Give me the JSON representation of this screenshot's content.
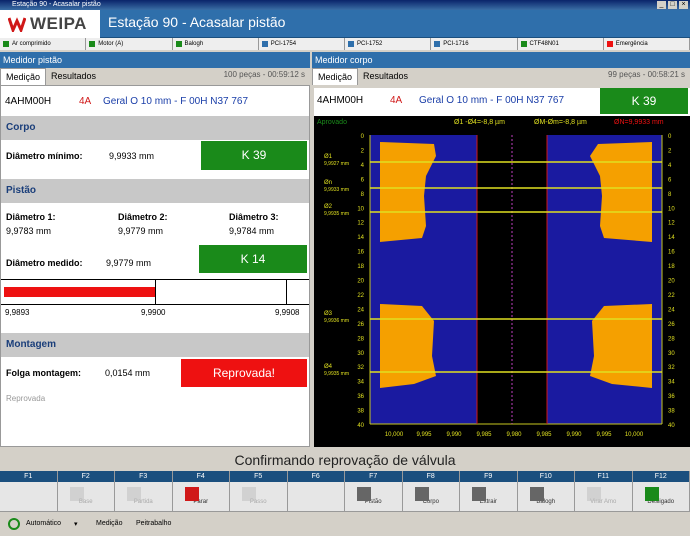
{
  "window": {
    "title": "Estação 90 - Acasalar pistão"
  },
  "header": {
    "logo": "WEIPA",
    "title": "Estação 90 - Acasalar pistão"
  },
  "status": [
    {
      "label": "Ar comprimido",
      "color": "#1a8a1a"
    },
    {
      "label": "Motor (A)",
      "color": "#1a8a1a"
    },
    {
      "label": "Balogh",
      "color": "#1a8a1a"
    },
    {
      "label": "PCI-1754",
      "color": "#2f6fab"
    },
    {
      "label": "PCI-1752",
      "color": "#2f6fab"
    },
    {
      "label": "PCI-1716",
      "color": "#2f6fab"
    },
    {
      "label": "CTF48N01",
      "color": "#1a8a1a"
    },
    {
      "label": "Emergência",
      "color": "#ee1111"
    }
  ],
  "left": {
    "head": "Medidor pistão",
    "tabs": [
      "Medição",
      "Resultados"
    ],
    "count": "100 peças - 00:59:12 s",
    "code": "4AHM00H",
    "cls": "4A",
    "desc": "Geral O 10 mm - F 00H N37 767",
    "corpo": {
      "title": "Corpo",
      "label": "Diâmetro mínimo:",
      "value": "9,9933 mm",
      "k": "K 39"
    },
    "pistao": {
      "title": "Pistão",
      "d1l": "Diâmetro 1:",
      "d1": "9,9783 mm",
      "d2l": "Diâmetro 2:",
      "d2": "9,9779 mm",
      "d3l": "Diâmetro 3:",
      "d3": "9,9784 mm",
      "medl": "Diâmetro medido:",
      "med": "9,9779 mm",
      "k": "K 14"
    },
    "scale": {
      "a": "9,9893",
      "b": "9,9900",
      "c": "9,9908",
      "level": 0.5
    },
    "montagem": {
      "title": "Montagem",
      "label": "Folga montagem:",
      "value": "0,0154 mm",
      "status": "Reprovada!",
      "note": "Reprovada"
    }
  },
  "right": {
    "head": "Medidor corpo",
    "tabs": [
      "Medição",
      "Resultados"
    ],
    "count": "99 peças - 00:58:21 s",
    "code": "4AHM00H",
    "cls": "4A",
    "desc": "Geral O 10 mm - F 00H N37 767",
    "k": "K 39",
    "chart": {
      "status": "Aprovado",
      "leg1": "Ø1 -Ø4=-8,8 µm",
      "leg2": "ØM-Øm=-8,8 µm",
      "leg3": "ØN=9,9933 mm",
      "markers": [
        {
          "n": "Ø1",
          "v": "9,9927 mm"
        },
        {
          "n": "Øn",
          "v": "9,9933 mm"
        },
        {
          "n": "Ø2",
          "v": "9,9935 mm"
        },
        {
          "n": "Ø3",
          "v": "9,9936 mm"
        },
        {
          "n": "Ø4",
          "v": "9,9935 mm"
        }
      ],
      "yticks": [
        "0",
        "2",
        "4",
        "6",
        "8",
        "10",
        "12",
        "14",
        "16",
        "18",
        "20",
        "22",
        "24",
        "26",
        "28",
        "30",
        "32",
        "34",
        "36",
        "38",
        "40"
      ],
      "xticks": [
        "10,000",
        "9,995",
        "9,990",
        "9,985",
        "9,980",
        "9,985",
        "9,990",
        "9,995",
        "10,000"
      ]
    }
  },
  "bottom": {
    "message": "Confirmando reprovação de válvula"
  },
  "fkeys": [
    {
      "f": "F1",
      "l": ""
    },
    {
      "f": "F2",
      "l": "Base",
      "dim": true
    },
    {
      "f": "F3",
      "l": "Partida",
      "dim": true
    },
    {
      "f": "F4",
      "l": "Parar"
    },
    {
      "f": "F5",
      "l": "Passo",
      "dim": true
    },
    {
      "f": "F6",
      "l": ""
    },
    {
      "f": "F7",
      "l": "Pistão"
    },
    {
      "f": "F8",
      "l": "Corpo"
    },
    {
      "f": "F9",
      "l": "Extrair"
    },
    {
      "f": "F10",
      "l": "Balogh"
    },
    {
      "f": "F11",
      "l": "Virar Amo",
      "dim": true
    },
    {
      "f": "F12",
      "l": "Desligado"
    }
  ],
  "footer": {
    "mode": "Automático",
    "b1": "Medição",
    "b2": "Peitrabalho"
  }
}
